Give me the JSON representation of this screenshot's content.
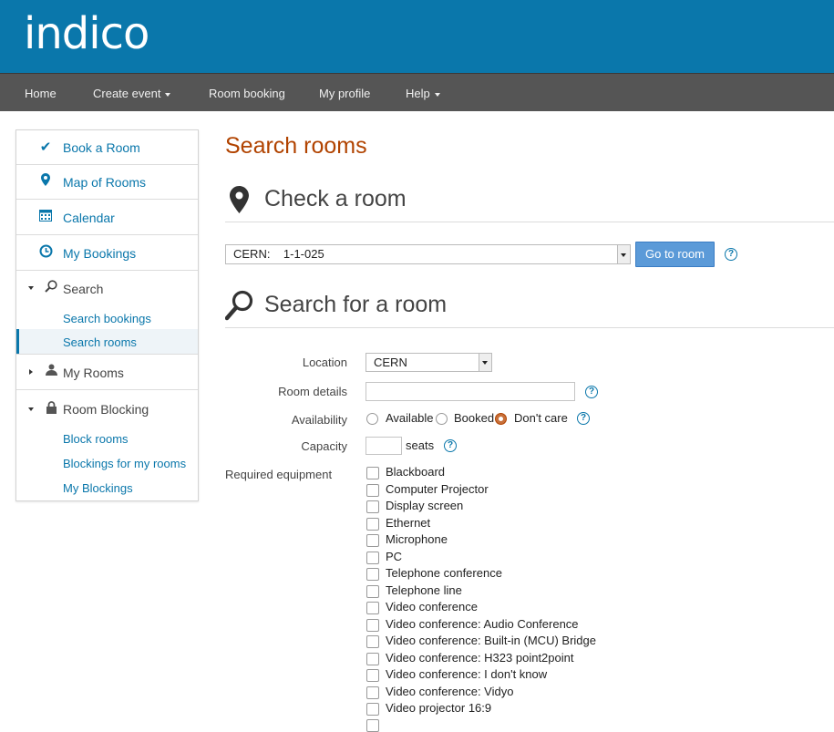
{
  "brand": {
    "logo_text": "indico"
  },
  "nav": {
    "home": "Home",
    "create_event": "Create event",
    "room_booking": "Room booking",
    "my_profile": "My profile",
    "help": "Help"
  },
  "sidebar": {
    "book_room": "Book a Room",
    "map_rooms": "Map of Rooms",
    "calendar": "Calendar",
    "my_bookings": "My Bookings",
    "search": "Search",
    "search_bookings": "Search bookings",
    "search_rooms": "Search rooms",
    "my_rooms": "My Rooms",
    "room_blocking": "Room Blocking",
    "block_rooms": "Block rooms",
    "blockings_my_rooms": "Blockings for my rooms",
    "my_blockings": "My Blockings"
  },
  "page": {
    "title": "Search rooms",
    "check_heading": "Check a room",
    "room_select_value": "CERN:    1-1-025",
    "go_button": "Go to room",
    "search_heading": "Search for a room"
  },
  "form": {
    "location_label": "Location",
    "location_value": "CERN",
    "room_details_label": "Room details",
    "availability_label": "Availability",
    "availability_options": [
      "Available",
      "Booked",
      "Don't care"
    ],
    "availability_selected": "Don't care",
    "capacity_label": "Capacity",
    "seats_label": "seats",
    "equipment_label": "Required equipment",
    "equipment": [
      "Blackboard",
      "Computer Projector",
      "Display screen",
      "Ethernet",
      "Microphone",
      "PC",
      "Telephone conference",
      "Telephone line",
      "Video conference",
      "Video conference: Audio Conference",
      "Video conference: Built-in (MCU) Bridge",
      "Video conference: H323 point2point",
      "Video conference: I don't know",
      "Video conference: Vidyo",
      "Video projector 16:9"
    ]
  },
  "colors": {
    "brand_blue": "#0a77ab",
    "title_orange": "#b14300",
    "nav_gray": "#555555",
    "button_blue": "#5b9ad8"
  }
}
